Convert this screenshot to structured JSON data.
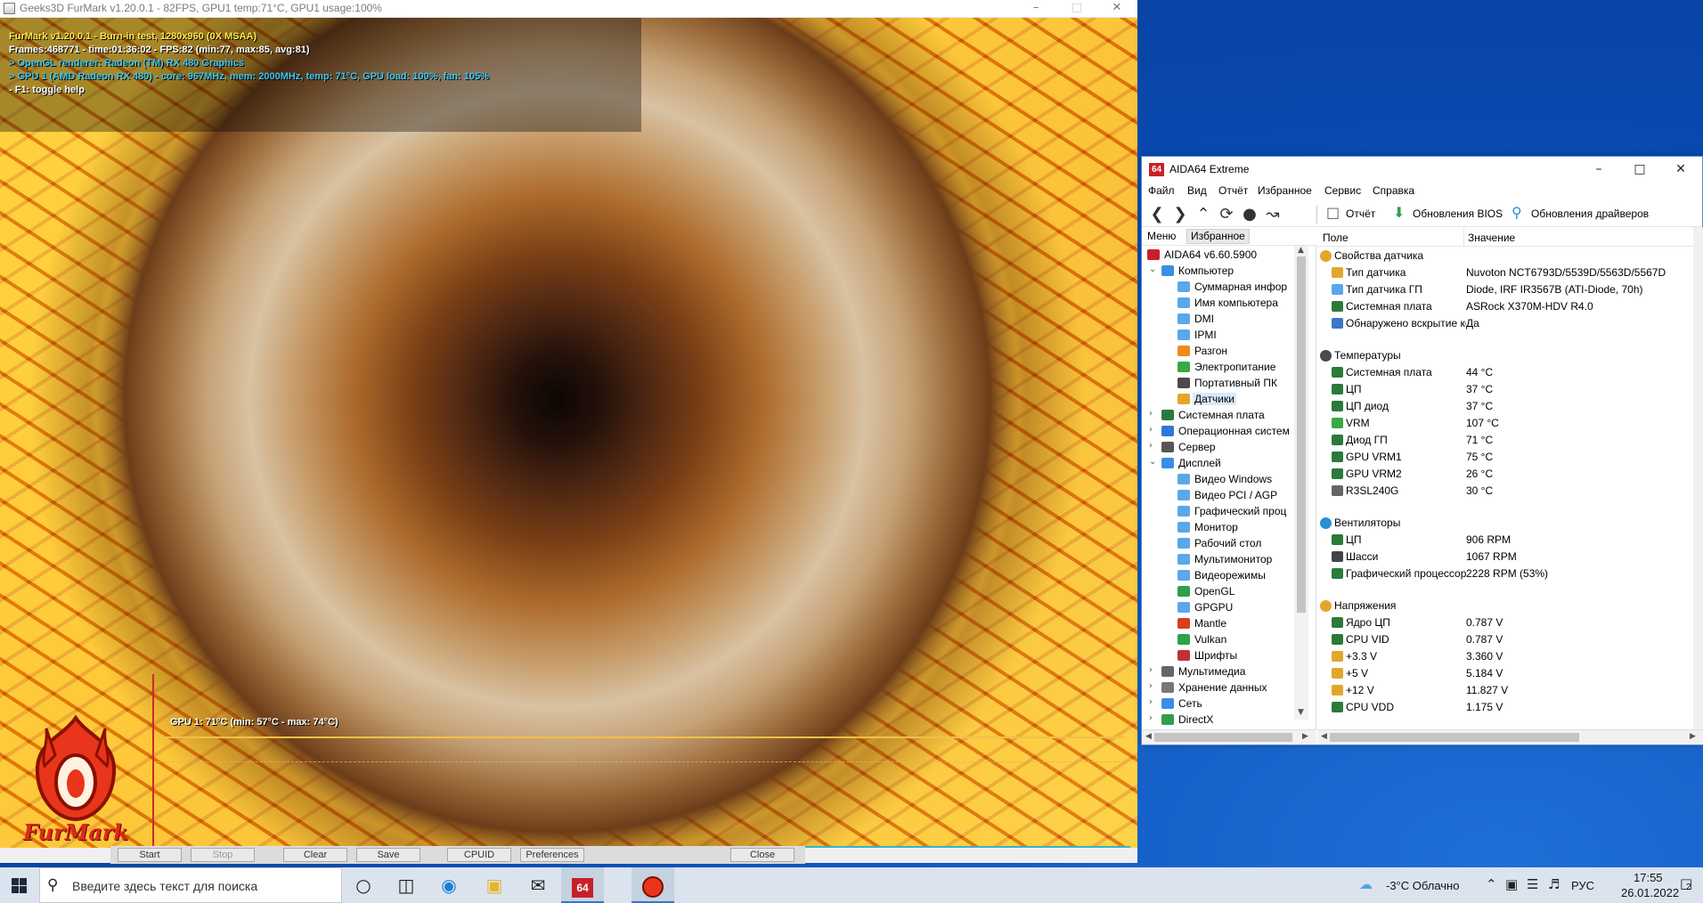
{
  "furmark": {
    "window_title": "Geeks3D FurMark v1.20.0.1 - 82FPS, GPU1 temp:71°C, GPU1 usage:100%",
    "info": {
      "line1": "FurMark v1.20.0.1 - Burn-in test, 1280x960 (0X MSAA)",
      "line2": "Frames:468771 - time:01:36:02 - FPS:82 (min:77, max:85, avg:81)",
      "line3": "> OpenGL renderer: Radeon (TM) RX 480 Graphics",
      "line4": "> GPU 1 (AMD Radeon RX 480) - core: 967MHz, mem: 2000MHz, temp: 71°C, GPU load: 100%, fan: 105%",
      "line5": "- F1: toggle help"
    },
    "graph_label": "GPU 1: 71°C (min: 57°C - max: 74°C)",
    "gpu_temp_c": 71,
    "logo_text": "FurMark",
    "buttons": {
      "start": "Start",
      "stop": "Stop",
      "clear": "Clear",
      "save": "Save",
      "cpuid": "CPUID",
      "preferences": "Preferences",
      "close": "Close"
    },
    "colors": {
      "info_yellow": "#ffe74a",
      "info_white": "#ffffff",
      "info_cyan": "#3fc7f0"
    }
  },
  "aida": {
    "window_title": "AIDA64 Extreme",
    "logo": "64",
    "menu": [
      "Файл",
      "Вид",
      "Отчёт",
      "Избранное",
      "Сервис",
      "Справка"
    ],
    "toolbar": {
      "report": "Отчёт",
      "bios_updates": "Обновления BIOS",
      "driver_updates": "Обновления драйверов"
    },
    "tabs": {
      "menu": "Меню",
      "favorites": "Избранное"
    },
    "tree": [
      {
        "label": "AIDA64 v6.60.5900",
        "level": 0,
        "arrow": "",
        "icon": "#c8202a"
      },
      {
        "label": "Компьютер",
        "level": 1,
        "arrow": "v",
        "icon": "#3a8ee6"
      },
      {
        "label": "Суммарная инфор",
        "level": 2,
        "arrow": "",
        "icon": "#5aa7ea"
      },
      {
        "label": "Имя компьютера",
        "level": 2,
        "arrow": "",
        "icon": "#5aa7ea"
      },
      {
        "label": "DMI",
        "level": 2,
        "arrow": "",
        "icon": "#5aa7ea"
      },
      {
        "label": "IPMI",
        "level": 2,
        "arrow": "",
        "icon": "#5aa7ea"
      },
      {
        "label": "Разгон",
        "level": 2,
        "arrow": "",
        "icon": "#f08a1c"
      },
      {
        "label": "Электропитание",
        "level": 2,
        "arrow": "",
        "icon": "#3aa845"
      },
      {
        "label": "Портативный ПК",
        "level": 2,
        "arrow": "",
        "icon": "#4a4a4a"
      },
      {
        "label": "Датчики",
        "level": 2,
        "arrow": "",
        "icon": "#e2a72a",
        "selected": true
      },
      {
        "label": "Системная плата",
        "level": 1,
        "arrow": ">",
        "icon": "#2c7a3a"
      },
      {
        "label": "Операционная систем",
        "level": 1,
        "arrow": ">",
        "icon": "#2b78d8"
      },
      {
        "label": "Сервер",
        "level": 1,
        "arrow": ">",
        "icon": "#555555"
      },
      {
        "label": "Дисплей",
        "level": 1,
        "arrow": "v",
        "icon": "#3a8ee6"
      },
      {
        "label": "Видео Windows",
        "level": 2,
        "arrow": "",
        "icon": "#5aa7ea"
      },
      {
        "label": "Видео PCI / AGP",
        "level": 2,
        "arrow": "",
        "icon": "#5aa7ea"
      },
      {
        "label": "Графический проц",
        "level": 2,
        "arrow": "",
        "icon": "#5aa7ea"
      },
      {
        "label": "Монитор",
        "level": 2,
        "arrow": "",
        "icon": "#5aa7ea"
      },
      {
        "label": "Рабочий стол",
        "level": 2,
        "arrow": "",
        "icon": "#5aa7ea"
      },
      {
        "label": "Мультимонитор",
        "level": 2,
        "arrow": "",
        "icon": "#5aa7ea"
      },
      {
        "label": "Видеорежимы",
        "level": 2,
        "arrow": "",
        "icon": "#5aa7ea"
      },
      {
        "label": "OpenGL",
        "level": 2,
        "arrow": "",
        "icon": "#2fa04a"
      },
      {
        "label": "GPGPU",
        "level": 2,
        "arrow": "",
        "icon": "#5aa7ea"
      },
      {
        "label": "Mantle",
        "level": 2,
        "arrow": "",
        "icon": "#d8401c"
      },
      {
        "label": "Vulkan",
        "level": 2,
        "arrow": "",
        "icon": "#2fa04a"
      },
      {
        "label": "Шрифты",
        "level": 2,
        "arrow": "",
        "icon": "#c43030"
      },
      {
        "label": "Мультимедиа",
        "level": 1,
        "arrow": ">",
        "icon": "#666666"
      },
      {
        "label": "Хранение данных",
        "level": 1,
        "arrow": ">",
        "icon": "#777777"
      },
      {
        "label": "Сеть",
        "level": 1,
        "arrow": ">",
        "icon": "#3a8ee6"
      },
      {
        "label": "DirectX",
        "level": 1,
        "arrow": ">",
        "icon": "#2fa04a"
      }
    ],
    "grid": {
      "col_field": "Поле",
      "col_value": "Значение",
      "sections": [
        {
          "title": "Свойства датчика",
          "icon": "#e2a72a",
          "rows": [
            {
              "k": "Тип датчика",
              "v": "Nuvoton NCT6793D/5539D/5563D/5567D",
              "icon": "#e2a72a"
            },
            {
              "k": "Тип датчика ГП",
              "v": "Diode, IRF IR3567B  (ATI-Diode, 70h)",
              "icon": "#5aa7ea"
            },
            {
              "k": "Системная плата",
              "v": "ASRock X370M-HDV R4.0",
              "icon": "#2c7a3a"
            },
            {
              "k": "Обнаружено вскрытие кор...",
              "v": "Да",
              "icon": "#3a78c8"
            }
          ]
        },
        {
          "title": "Температуры",
          "icon": "#4a4a4a",
          "rows": [
            {
              "k": "Системная плата",
              "v": "44 °C",
              "icon": "#2c7a3a"
            },
            {
              "k": "ЦП",
              "v": "37 °C",
              "icon": "#2c7a3a"
            },
            {
              "k": "ЦП диод",
              "v": "37 °C",
              "icon": "#2c7a3a"
            },
            {
              "k": "VRM",
              "v": "107 °C",
              "icon": "#3aa845"
            },
            {
              "k": "Диод ГП",
              "v": "71 °C",
              "icon": "#2c7a3a"
            },
            {
              "k": "GPU VRM1",
              "v": "75 °C",
              "icon": "#2c7a3a"
            },
            {
              "k": "GPU VRM2",
              "v": "26 °C",
              "icon": "#2c7a3a"
            },
            {
              "k": "R3SL240G",
              "v": "30 °C",
              "icon": "#666666"
            }
          ]
        },
        {
          "title": "Вентиляторы",
          "icon": "#2b8fd6",
          "rows": [
            {
              "k": "ЦП",
              "v": "906 RPM",
              "icon": "#2c7a3a"
            },
            {
              "k": "Шасси",
              "v": "1067 RPM",
              "icon": "#444444"
            },
            {
              "k": "Графический процессор",
              "v": "2228 RPM  (53%)",
              "icon": "#2c7a3a"
            }
          ]
        },
        {
          "title": "Напряжения",
          "icon": "#e2a72a",
          "rows": [
            {
              "k": "Ядро ЦП",
              "v": "0.787 V",
              "icon": "#2c7a3a"
            },
            {
              "k": "CPU VID",
              "v": "0.787 V",
              "icon": "#2c7a3a"
            },
            {
              "k": "+3.3 V",
              "v": "3.360 V",
              "icon": "#e2a72a"
            },
            {
              "k": "+5 V",
              "v": "5.184 V",
              "icon": "#e2a72a"
            },
            {
              "k": "+12 V",
              "v": "11.827 V",
              "icon": "#e2a72a"
            },
            {
              "k": "CPU VDD",
              "v": "1.175 V",
              "icon": "#2c7a3a"
            }
          ]
        }
      ]
    }
  },
  "taskbar": {
    "search_placeholder": "Введите здесь текст для поиска",
    "weather": "-3°C  Облачно",
    "language": "РУС",
    "time": "17:55",
    "date": "26.01.2022",
    "notification_count": "2"
  }
}
